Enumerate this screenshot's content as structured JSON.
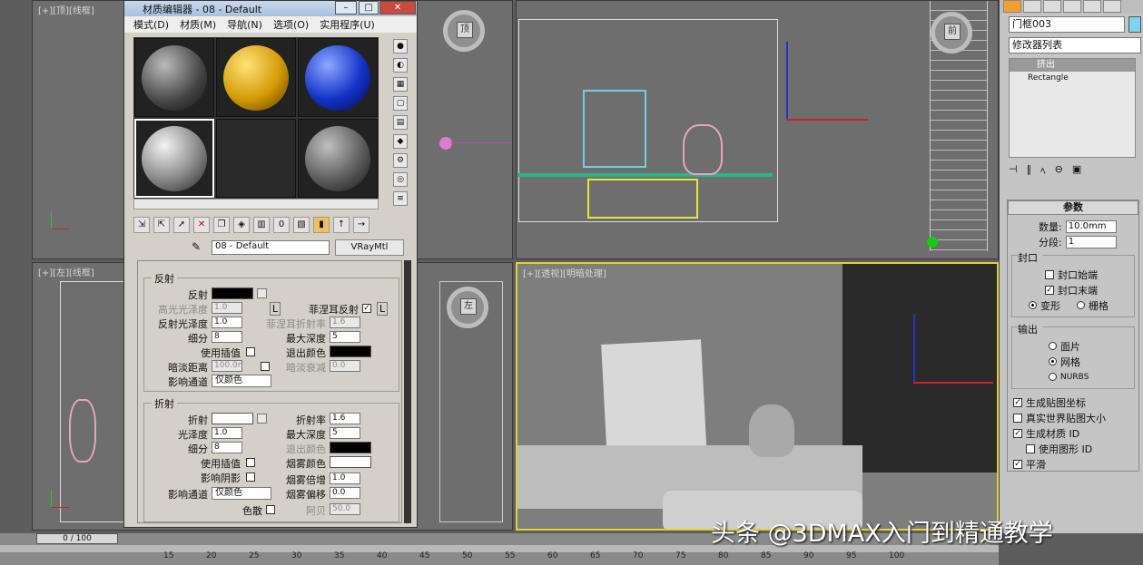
{
  "mat_editor": {
    "title": "材质编辑器 - 08 - Default",
    "menu": [
      "模式(D)",
      "材质(M)",
      "导航(N)",
      "选项(O)",
      "实用程序(U)"
    ],
    "material_name": "08 - Default",
    "material_type": "VRayMtl",
    "reflect": {
      "group": "反射",
      "reflect_label": "反射",
      "hilight_gloss_label": "高光光泽度",
      "hilight_gloss_value": "1.0",
      "refl_gloss_label": "反射光泽度",
      "refl_gloss_value": "1.0",
      "subdivs_label": "细分",
      "subdivs_value": "8",
      "use_interp_label": "使用插值",
      "dim_dist_label": "暗淡距离",
      "dim_dist_value": "100.0n",
      "affect_channels_label": "影响通道",
      "affect_channels_value": "仅颜色",
      "fresnel_label": "菲涅耳反射",
      "fresnel_ior_label": "菲涅耳折射率",
      "fresnel_ior_value": "1.6",
      "max_depth_label": "最大深度",
      "max_depth_value": "5",
      "exit_color_label": "退出颜色",
      "dim_falloff_label": "暗淡衰减",
      "dim_falloff_value": "0.0",
      "l_label": "L"
    },
    "refract": {
      "group": "折射",
      "refract_label": "折射",
      "gloss_label": "光泽度",
      "gloss_value": "1.0",
      "subdivs_label": "细分",
      "subdivs_value": "8",
      "use_interp_label": "使用插值",
      "affect_shadows_label": "影响阴影",
      "affect_channels_label": "影响通道",
      "affect_channels_value": "仅颜色",
      "ior_label": "折射率",
      "ior_value": "1.6",
      "max_depth_label": "最大深度",
      "max_depth_value": "5",
      "exit_color_label": "退出颜色",
      "fog_color_label": "烟雾颜色",
      "fog_mult_label": "烟雾倍增",
      "fog_mult_value": "1.0",
      "fog_bias_label": "烟雾偏移",
      "fog_bias_value": "0.0",
      "dispersion_label": "色散",
      "abbe_label": "阿贝",
      "abbe_value": "50.0"
    }
  },
  "viewports": {
    "top_left": "[+][顶][线框]",
    "left": "[+][左][线框]",
    "perspective": "[+][透视][明暗处理]",
    "navcube_top": "顶",
    "navcube_front": "前",
    "navcube_left": "左"
  },
  "command_panel": {
    "object_name": "门框003",
    "modifier_list": "修改器列表",
    "stack": [
      "挤出",
      "Rectangle"
    ],
    "params_title": "参数",
    "amount_label": "数量:",
    "amount_value": "10.0mm",
    "segments_label": "分段:",
    "segments_value": "1",
    "capping_title": "封口",
    "cap_start": "封口始端",
    "cap_end": "封口末端",
    "morph": "变形",
    "grid": "栅格",
    "output_title": "输出",
    "out_patch": "面片",
    "out_mesh": "网格",
    "out_nurbs": "NURBS",
    "gen_map_coords": "生成贴图坐标",
    "real_world": "真实世界贴图大小",
    "gen_mat_ids": "生成材质 ID",
    "use_shape_ids": "使用图形 ID",
    "smooth": "平滑"
  },
  "timeline": {
    "frame": "0 / 100",
    "ticks": [
      "15",
      "20",
      "25",
      "30",
      "35",
      "40",
      "45",
      "50",
      "55",
      "60",
      "65",
      "70",
      "75",
      "80",
      "85",
      "90",
      "95",
      "100"
    ]
  },
  "watermark": "头条 @3DMAX入门到精通教学"
}
